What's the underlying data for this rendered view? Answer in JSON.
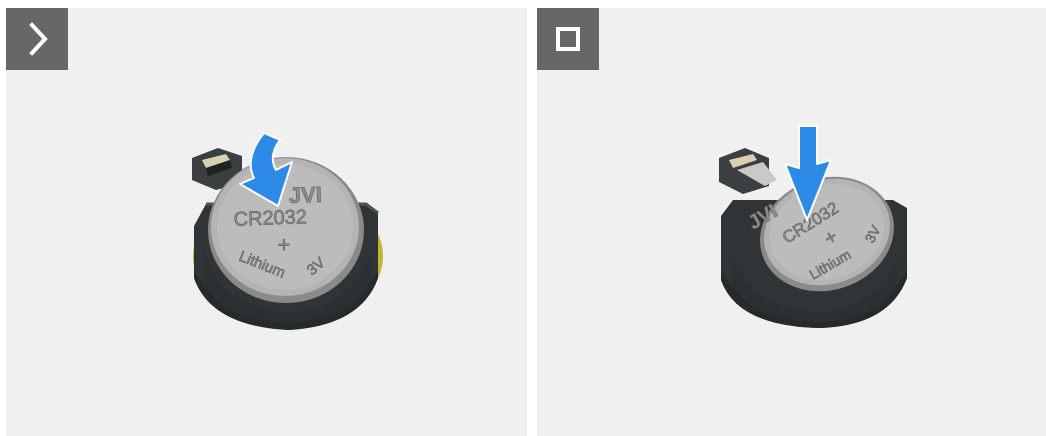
{
  "panels": [
    {
      "badge_icon": "chevron-right-icon",
      "coin": {
        "brand": "JVI",
        "model": "CR2032",
        "plus": "+",
        "chem": "Lithium",
        "volts": "3V"
      },
      "arrow_color": "#2d8ae6"
    },
    {
      "badge_icon": "stop-square-icon",
      "coin": {
        "brand": "JVI",
        "model": "CR2032",
        "plus": "+",
        "chem": "Lithium",
        "volts": "3V"
      },
      "arrow_color": "#2d8ae6"
    }
  ],
  "colors": {
    "panel_bg": "#f0f0f0",
    "badge_bg": "#676767",
    "holder": "#33393a",
    "coin": "#b2b2b2",
    "pcb_edge": "#c8b23a"
  }
}
